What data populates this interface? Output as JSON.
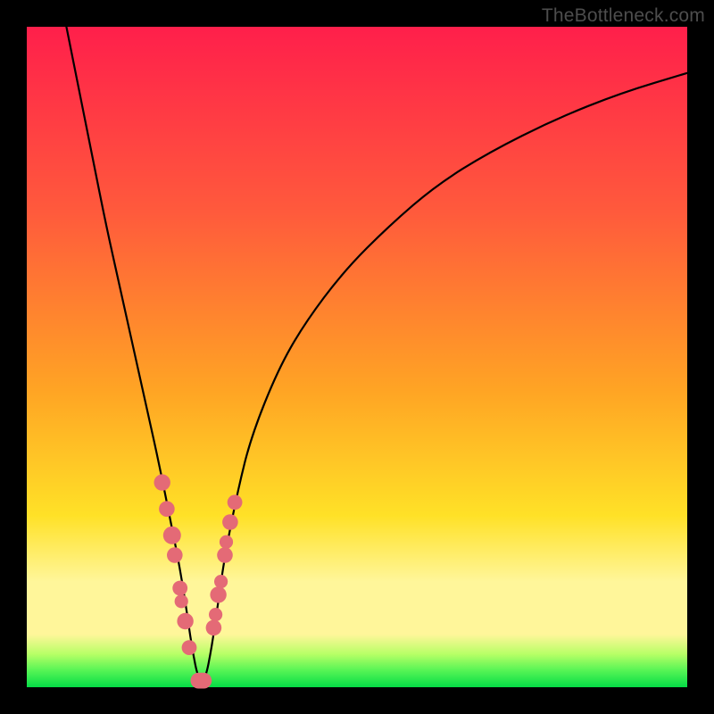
{
  "watermark": "TheBottleneck.com",
  "colors": {
    "top": "#ff1f4b",
    "upper": "#ff5a3c",
    "mid": "#ffa424",
    "yellow": "#ffe127",
    "pale": "#fff69a",
    "green_top": "#b7ff66",
    "green_mid": "#55f455",
    "green": "#05dc46",
    "marker": "#e46a76"
  },
  "chart_data": {
    "type": "line",
    "title": "",
    "xlabel": "",
    "ylabel": "",
    "xlim": [
      0,
      100
    ],
    "ylim": [
      0,
      100
    ],
    "note": "Absolute bottleneck deviation curve. Values are percentage read off the plot; y is deviation (0 = balanced, 100 = worst), x is relative hardware balance position. The notch minimum sits near x≈26.",
    "series": [
      {
        "name": "bottleneck-curve",
        "x": [
          6,
          8,
          10,
          12,
          14,
          16,
          18,
          20,
          22,
          23,
          24,
          25,
          26,
          27,
          28,
          29,
          30,
          32,
          34,
          38,
          42,
          48,
          55,
          62,
          70,
          80,
          90,
          100
        ],
        "y": [
          100,
          90,
          80,
          70,
          61,
          52,
          43,
          34,
          24,
          19,
          13,
          6,
          1,
          1,
          6,
          13,
          20,
          30,
          38,
          48,
          55,
          63,
          70,
          76,
          81,
          86,
          90,
          93
        ]
      }
    ],
    "markers": {
      "name": "highlighted-samples",
      "note": "Pink dot clusters along both flanks of the notch and a rounded bar across the trough.",
      "points": [
        {
          "x": 20.5,
          "y": 31,
          "r": 1.4
        },
        {
          "x": 21.2,
          "y": 27,
          "r": 1.3
        },
        {
          "x": 22.0,
          "y": 23,
          "r": 1.6
        },
        {
          "x": 22.4,
          "y": 20,
          "r": 1.3
        },
        {
          "x": 23.2,
          "y": 15,
          "r": 1.2
        },
        {
          "x": 23.4,
          "y": 13,
          "r": 1.0
        },
        {
          "x": 24.0,
          "y": 10,
          "r": 1.4
        },
        {
          "x": 24.6,
          "y": 6,
          "r": 1.2
        },
        {
          "x": 30.0,
          "y": 20,
          "r": 1.3
        },
        {
          "x": 30.2,
          "y": 22,
          "r": 1.0
        },
        {
          "x": 30.8,
          "y": 25,
          "r": 1.3
        },
        {
          "x": 31.5,
          "y": 28,
          "r": 1.2
        },
        {
          "x": 29.0,
          "y": 14,
          "r": 1.4
        },
        {
          "x": 29.4,
          "y": 16,
          "r": 1.0
        },
        {
          "x": 28.3,
          "y": 9,
          "r": 1.3
        },
        {
          "x": 28.6,
          "y": 11,
          "r": 1.0
        }
      ],
      "trough_bar": {
        "x0": 24.8,
        "x1": 28.0,
        "y": 1.0,
        "thickness": 2.4
      }
    }
  }
}
